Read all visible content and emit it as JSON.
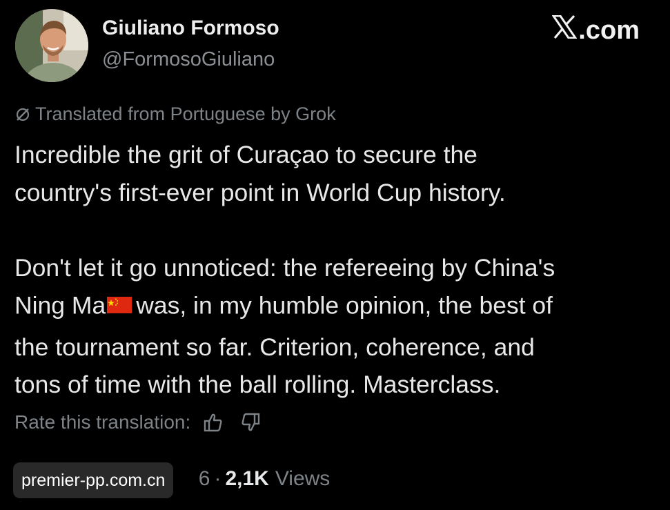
{
  "author": {
    "display_name": "Giuliano Formoso",
    "handle": "@FormosoGiuliano"
  },
  "brand": {
    "label": ".com",
    "logo_icon": "x-logo-icon"
  },
  "translation_notice": {
    "icon": "grok-icon",
    "text": "Translated from Portuguese by Grok"
  },
  "tweet": {
    "paragraph1": [
      "Incredible the grit of Curaçao to secure the",
      "country's first-ever point in World Cup history."
    ],
    "paragraph2": {
      "line1": "Don't let it go unnoticed: the refereeing by China's",
      "line2_before_flag": "Ning Ma",
      "flag_icon": "china-flag-icon",
      "line2_after_flag": "was, in my humble opinion, the best of",
      "line3": "the tournament so far. Criterion, coherence, and",
      "line4": "tons of time with the ball rolling. Masterclass."
    }
  },
  "rate_translation": {
    "label": "Rate this translation:",
    "thumbs_up_icon": "thumbs-up-icon",
    "thumbs_down_icon": "thumbs-down-icon"
  },
  "meta": {
    "partial_date": "6",
    "separator": "·",
    "views_count": "2,1K",
    "views_label": "Views"
  },
  "watermark": {
    "text": "premier-pp.com.cn"
  },
  "colors": {
    "background": "#000000",
    "primary_text": "#e8e8e8",
    "secondary_text": "#7e8388",
    "flag_red": "#de2910",
    "flag_yellow": "#ffde00"
  }
}
